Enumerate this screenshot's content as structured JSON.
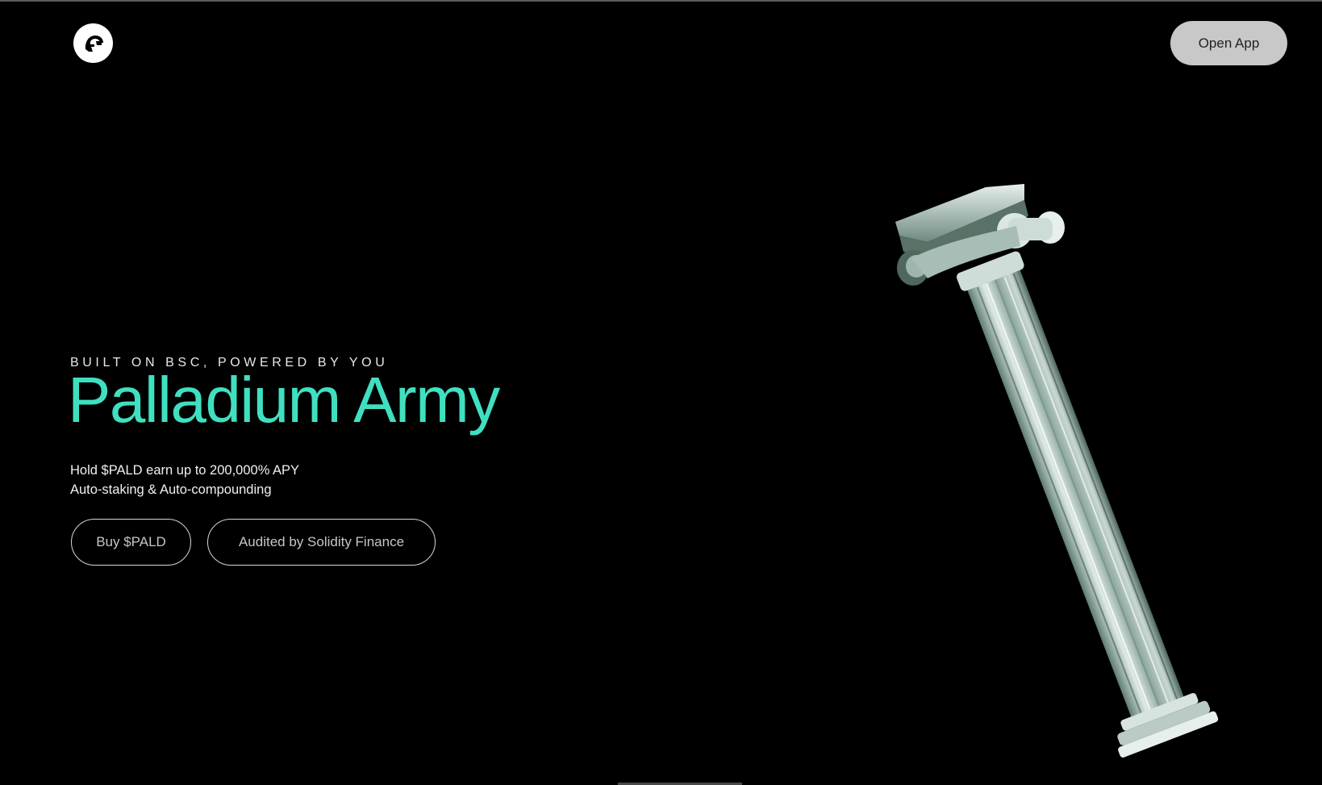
{
  "header": {
    "logo_icon": "spartan-helmet-icon",
    "open_app_label": "Open App"
  },
  "hero": {
    "tagline": "BUILT ON BSC, POWERED BY YOU",
    "title": "Palladium Army",
    "subtext_line1": "Hold $PALD earn up to 200,000% APY",
    "subtext_line2": "Auto-staking & Auto-compounding",
    "buy_label": "Buy $PALD",
    "audit_label": "Audited by Solidity Finance"
  },
  "decor": {
    "column_image": "ionic-column-icon"
  },
  "colors": {
    "background": "#000000",
    "accent": "#3fe0c1",
    "button_fill": "#c8c8c8"
  }
}
